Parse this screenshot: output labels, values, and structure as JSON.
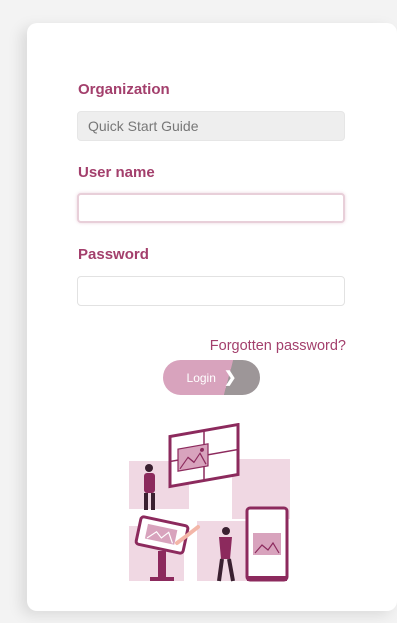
{
  "organization": {
    "label": "Organization",
    "value": "Quick Start Guide"
  },
  "username": {
    "label": "User name",
    "value": ""
  },
  "password": {
    "label": "Password",
    "value": ""
  },
  "forgot_link": "Forgotten password?",
  "login_button": {
    "label": "Login",
    "icon": "chevron-right-icon"
  },
  "illustration": "people-with-screens-illustration",
  "colors": {
    "accent": "#a33f6c",
    "button": "#d8a3bd",
    "illustration_dark": "#8c2a5d",
    "illustration_light": "#f0d8e3"
  }
}
